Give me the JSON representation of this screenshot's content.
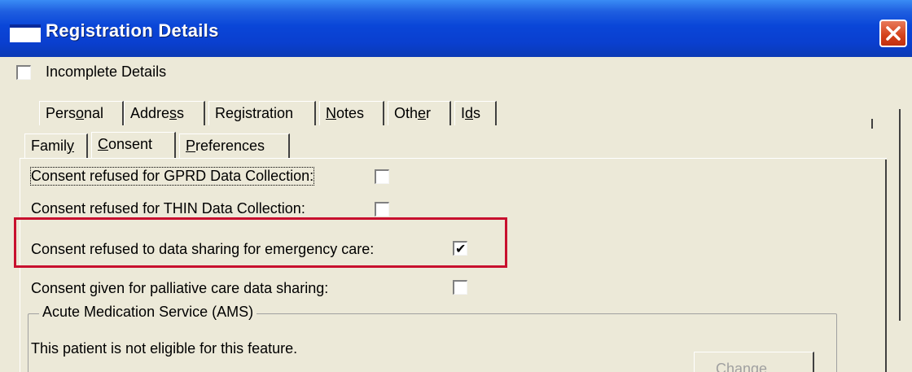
{
  "window": {
    "title": "Registration Details"
  },
  "incomplete_details": {
    "label": "Incomplete Details",
    "checked": false
  },
  "tabs_row1": [
    {
      "pre": "Pers",
      "u": "o",
      "post": "nal"
    },
    {
      "pre": "Addre",
      "u": "s",
      "post": "s"
    },
    {
      "pre": "Re",
      "u": "g",
      "post": "istration"
    },
    {
      "pre": "",
      "u": "N",
      "post": "otes"
    },
    {
      "pre": "Oth",
      "u": "e",
      "post": "r"
    },
    {
      "pre": "I",
      "u": "d",
      "post": "s"
    }
  ],
  "tabs_row2": [
    {
      "pre": "Famil",
      "u": "y",
      "post": ""
    },
    {
      "pre": "",
      "u": "C",
      "post": "onsent"
    },
    {
      "pre": "",
      "u": "P",
      "post": "references"
    }
  ],
  "active_tab": "Consent",
  "consent": {
    "gprd": {
      "label": "Consent refused for GPRD Data Collection:",
      "checked": false
    },
    "thin": {
      "label": "Consent refused for THIN Data Collection:",
      "checked": false
    },
    "emergency": {
      "label": "Consent refused to data sharing for emergency care:",
      "checked": true
    },
    "palliative": {
      "label": "Consent given for palliative care data sharing:",
      "checked": false
    }
  },
  "ams": {
    "title": "Acute Medication Service (AMS)",
    "message": "This patient is not eligible for this feature.",
    "button": "Change..."
  },
  "colors": {
    "titlebar": "#0a46d8",
    "highlight": "#c8102e",
    "face": "#ece9d8"
  },
  "icons": {
    "window": "window-icon",
    "close": "close-icon",
    "check": "checkmark-icon"
  }
}
